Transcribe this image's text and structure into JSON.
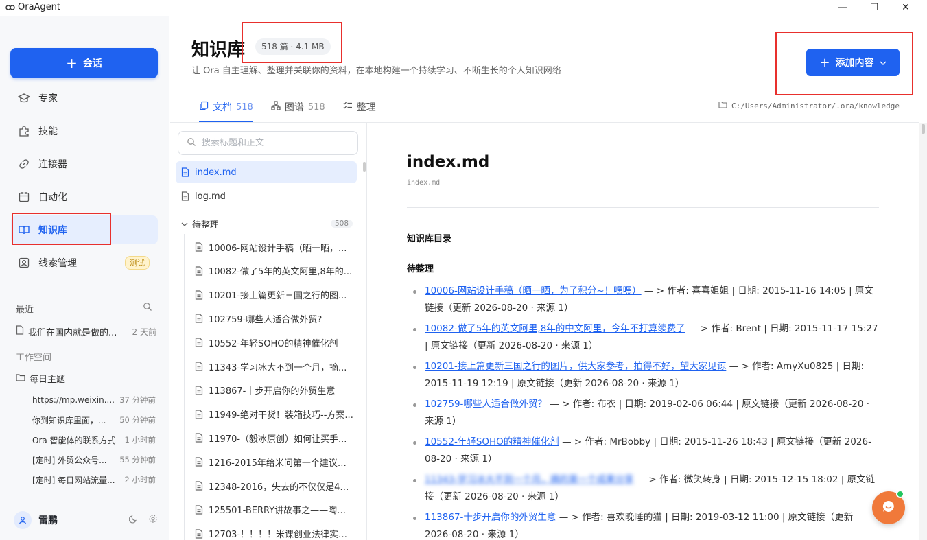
{
  "app": {
    "title": "OraAgent",
    "logo_glyph": "ORA"
  },
  "window_controls": {
    "minimize": "—",
    "maximize": "☐",
    "close": "✕"
  },
  "sidebar": {
    "new_chat_label": "会话",
    "nav": [
      {
        "label": "专家",
        "icon": "graduation-cap-icon"
      },
      {
        "label": "技能",
        "icon": "puzzle-icon"
      },
      {
        "label": "连接器",
        "icon": "link-icon"
      },
      {
        "label": "自动化",
        "icon": "calendar-icon"
      },
      {
        "label": "知识库",
        "icon": "book-icon",
        "active": true
      },
      {
        "label": "线索管理",
        "icon": "contact-icon",
        "badge": "测试"
      }
    ],
    "recent_label": "最近",
    "recent": [
      {
        "title": "我们在国内就是做的...",
        "time": "2 天前"
      }
    ],
    "workspace_label": "工作空间",
    "folder": {
      "name": "每日主题"
    },
    "folder_items": [
      {
        "title": "https://mp.weixin....",
        "time": "37 分钟前"
      },
      {
        "title": "你到知识库里面，...",
        "time": "50 分钟前"
      },
      {
        "title": "Ora 智能体的联系方式",
        "time": "1 小时前"
      },
      {
        "title": "[定时] 外贸公众号...",
        "time": "55 分钟前"
      },
      {
        "title": "[定时] 每日网站流量...",
        "time": "2 小时前"
      }
    ],
    "user": {
      "name": "雷鹏"
    }
  },
  "header": {
    "title": "知识库",
    "stats": "518 篇 · 4.1 MB",
    "description": "让 Ora 自主理解、整理并关联你的资料，在本地构建一个持续学习、不断生长的个人知识网络",
    "add_button": "添加内容"
  },
  "tabs": [
    {
      "label": "文档",
      "count": "518",
      "active": true
    },
    {
      "label": "图谱",
      "count": "518"
    },
    {
      "label": "整理",
      "count": ""
    }
  ],
  "storage_path": "C:/Users/Administrator/.ora/knowledge",
  "filelist": {
    "search_placeholder": "搜索标题和正文",
    "root_files": [
      "index.md",
      "log.md"
    ],
    "folder": {
      "name": "待整理",
      "count": "508"
    },
    "items": [
      "10006-网站设计手稿（晒一晒，...",
      "10082-做了5年的英文阿里,8年的...",
      "10201-接上篇更新三国之行的图...",
      "102759-哪些人适合做外贸?",
      "10552-年轻SOHO的精神催化剂",
      "11343-学习冰大不到一个月，摘...",
      "113867-十步开启你的外贸生意",
      "11949-绝对干货！装箱技巧--方案...",
      "11970-（毅冰原创）如何让买手...",
      "1216-2015年给米问第一个建议，...",
      "12348-2016，失去的不仅仅是40...",
      "125501-BERRY讲故事之——陶朱...",
      "12703-！！！！米课创业法律实务..."
    ]
  },
  "document": {
    "title": "index.md",
    "path": "index.md",
    "heading_toc": "知识库目录",
    "heading_pending": "待整理",
    "entries": [
      {
        "link": "10006-网站设计手稿（晒一晒，为了积分~！嘿嘿）",
        "meta": " — > 作者: 喜喜姐姐 | 日期: 2015-11-16 14:05 | 原文链接（更新 2026-08-20 · 来源 1）"
      },
      {
        "link": "10082-做了5年的英文阿里,8年的中文阿里，今年不打算续费了",
        "meta": " — > 作者: Brent | 日期: 2015-11-17 15:27 | 原文链接（更新 2026-08-20 · 来源 1）"
      },
      {
        "link": "10201-接上篇更新三国之行的图片，供大家参考，拍得不好，望大家见谅",
        "meta": " — > 作者: AmyXu0825 | 日期: 2015-11-19 12:19 | 原文链接（更新 2026-08-20 · 来源 1）"
      },
      {
        "link": "102759-哪些人适合做外贸？",
        "meta": " — > 作者: 布衣 | 日期: 2019-02-06 06:44 | 原文链接（更新 2026-08-20 · 来源 1）"
      },
      {
        "link": "10552-年轻SOHO的精神催化剂",
        "meta": " — > 作者: MrBobby | 日期: 2015-11-26 18:43 | 原文链接（更新 2026-08-20 · 来源 1）"
      },
      {
        "link": "11343-学习冰大不到一个月，摘的第一个成果分享",
        "meta": " — > 作者: 微笑转身 | 日期: 2015-12-15 18:02 | 原文链接（更新 2026-08-20 · 来源 1）",
        "blurred": true
      },
      {
        "link": "113867-十步开启你的外贸生意",
        "meta": " — > 作者: 喜欢晚睡的猫 | 日期: 2019-03-12 11:00 | 原文链接（更新 2026-08-20 · 来源 1）"
      }
    ]
  },
  "colors": {
    "accent": "#1f62f0",
    "annotation": "#e8302d",
    "fab": "#f0793a"
  }
}
